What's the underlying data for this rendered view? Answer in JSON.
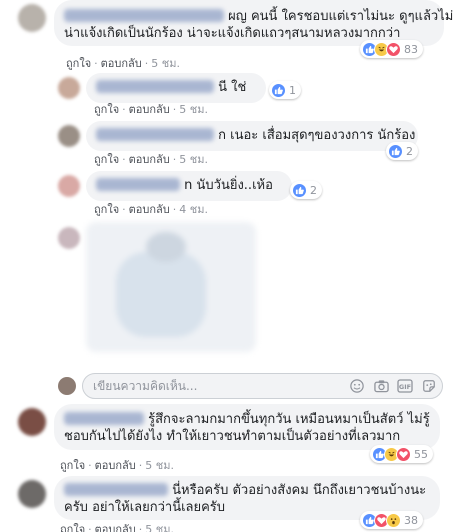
{
  "comment1": {
    "text_line1": "ผญ คนนี้ ใครชอบแต่เราไม่นะ ดูๆแล้วไม่",
    "text_line2": "น่าแจ้งเกิดเป็นนักร้อง น่าจะแจ้งเกิดแถวๆสนามหลวงมากกว่า",
    "like_label": "ถูกใจ",
    "reply_label": "ตอบกลับ",
    "time": "5 ชม.",
    "reaction_count": "83"
  },
  "reply1": {
    "text": "นี ใช่",
    "like_label": "ถูกใจ",
    "reply_label": "ตอบกลับ",
    "time": "5 ชม.",
    "reaction_count": "1"
  },
  "reply2": {
    "text": "ก เนอะ เสื่อมสุดๆของวงการ นักร้อง",
    "like_label": "ถูกใจ",
    "reply_label": "ตอบกลับ",
    "time": "5 ชม.",
    "reaction_count": "2"
  },
  "reply3": {
    "text": "n นับวันยิ่ง..เห้อ",
    "like_label": "ถูกใจ",
    "reply_label": "ตอบกลับ",
    "time": "4 ชม.",
    "reaction_count": "2"
  },
  "composer": {
    "placeholder": "เขียนความคิดเห็น..."
  },
  "comment2": {
    "text_line1": "รู้สึกจะลามกมากขึ้นทุกวัน เหมือนหมาเป็นสัตว์ ไม่รู้",
    "text_line2": "ชอบกันไปได้ยังไง ทำให้เยาวชนทำตามเป็นตัวอย่างที่เลวมาก",
    "like_label": "ถูกใจ",
    "reply_label": "ตอบกลับ",
    "time": "5 ชม.",
    "reaction_count": "55"
  },
  "comment3": {
    "text_line1": "นี่หรือครับ ตัวอย่างสังคม นึกถึงเยาวชนบ้างนะ",
    "text_line2": "ครับ อย่าให้เลยกว่านี้เลยครับ",
    "like_label": "ถูกใจ",
    "reply_label": "ตอบกลับ",
    "time": "5 ชม.",
    "reaction_count": "38"
  },
  "colors": {
    "link": "#385898",
    "meta": "#90949c",
    "bubble": "#f2f3f5",
    "like": "#5890ff",
    "love": "#f25268",
    "haha": "#f7c948"
  },
  "icons": [
    "like-icon",
    "haha-icon",
    "love-icon",
    "wow-icon",
    "emoji-icon",
    "camera-icon",
    "gif-icon",
    "sticker-icon"
  ]
}
